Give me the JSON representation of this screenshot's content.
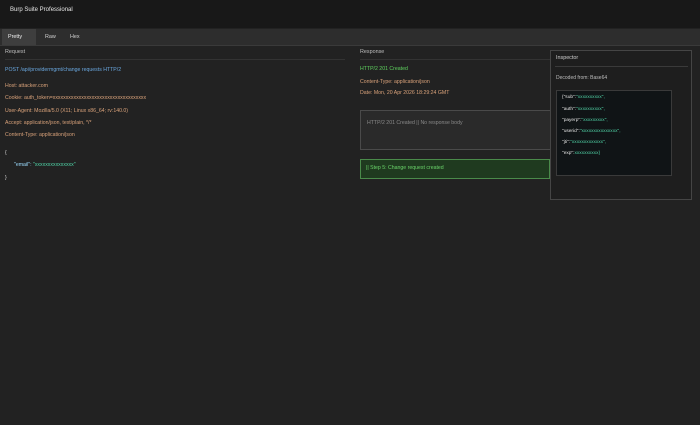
{
  "window": {
    "title": "Burp Suite Professional"
  },
  "tabs": [
    {
      "label": "Pretty",
      "active": true
    },
    {
      "label": "Raw",
      "active": false
    },
    {
      "label": "Hex",
      "active": false
    }
  ],
  "request": {
    "label": "Request",
    "lines": [
      "POST /api/providermgmt/change requests HTTP/2",
      "Host: attacker.com",
      "Cookie: auth_token=xxxxxxxxxxxxxxxxxxxxxxxxxxxxxxxxxxxx",
      "User-Agent: Mozilla/5.0 (X11; Linux x86_64; rv:140.0)",
      "Accept: application/json, text/plain, */*",
      "Content-Type: application/json"
    ],
    "body_open": "{",
    "body_key": "\"email\":",
    "body_value": "\"xxxxxxxxxxxxxxx\"",
    "body_close": "}"
  },
  "response": {
    "label": "Response",
    "status": "HTTP/2 201 Created",
    "content_type": "Content-Type: application/json",
    "date": "Date: Mon, 20 Apr 2026 18:29:24 GMT",
    "body_text": "HTTP/2 201 Created || No response body",
    "note": "|| Step 5: Change request created"
  },
  "inspector": {
    "title": "Inspector",
    "decoded_label": "Decoded from: Base64",
    "claims": [
      {
        "key": "{\"sub\":",
        "value": "\"xxxxxxxxxx\","
      },
      {
        "key": "\"auth\":",
        "value": "\"xxxxxxxxxx\","
      },
      {
        "key": "\"payerp\":",
        "value": "\"xxxxxxxxx\","
      },
      {
        "key": "\"userid\":",
        "value": "\"xxxxxxxxxxxxxxx\","
      },
      {
        "key": "\"jti\":",
        "value": "\"xxxxxxxxxxxxx\","
      },
      {
        "key": "\"exp\":",
        "value": "xxxxxxxxxx}"
      }
    ]
  }
}
